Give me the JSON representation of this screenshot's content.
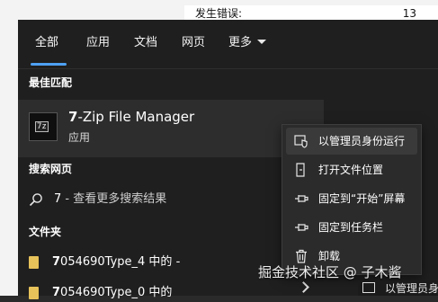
{
  "background": {
    "status_label": "发生错误:",
    "status_value": "13"
  },
  "tabs": [
    {
      "label": "全部",
      "active": true
    },
    {
      "label": "应用",
      "active": false
    },
    {
      "label": "文档",
      "active": false
    },
    {
      "label": "网页",
      "active": false
    },
    {
      "label": "更多",
      "active": false,
      "has_dropdown": true
    }
  ],
  "best_match": {
    "header": "最佳匹配",
    "icon_text": "7z",
    "title_bold": "7",
    "title_rest": "-Zip File Manager",
    "subtitle": "应用"
  },
  "web_search": {
    "header": "搜索网页",
    "query": "7",
    "suffix": " - 查看更多搜索结果"
  },
  "folders": {
    "header": "文件夹",
    "items": [
      {
        "bold": "7",
        "rest": "054690Type_4 中的 -"
      },
      {
        "bold": "7",
        "rest": "054690Type_0 中的"
      }
    ]
  },
  "context_menu": {
    "items": [
      {
        "label": "以管理员身份运行",
        "icon": "shield-admin-icon",
        "hover": true
      },
      {
        "label": "打开文件位置",
        "icon": "open-folder-icon",
        "hover": false
      },
      {
        "label": "固定到“开始”屏幕",
        "icon": "pin-icon",
        "hover": false
      },
      {
        "label": "固定到任务栏",
        "icon": "pin-icon",
        "hover": false
      },
      {
        "label": "卸载",
        "icon": "trash-icon",
        "hover": false
      }
    ]
  },
  "bottom_partial": {
    "label": "以管理员身"
  },
  "watermark": "掘金技术社区 @ 子木酱",
  "colors": {
    "accent": "#4ea1f3",
    "panel": "#1f1f1f",
    "selected": "#2d2d2d",
    "menu": "#2b2b2b",
    "folder": "#e7c25a"
  }
}
